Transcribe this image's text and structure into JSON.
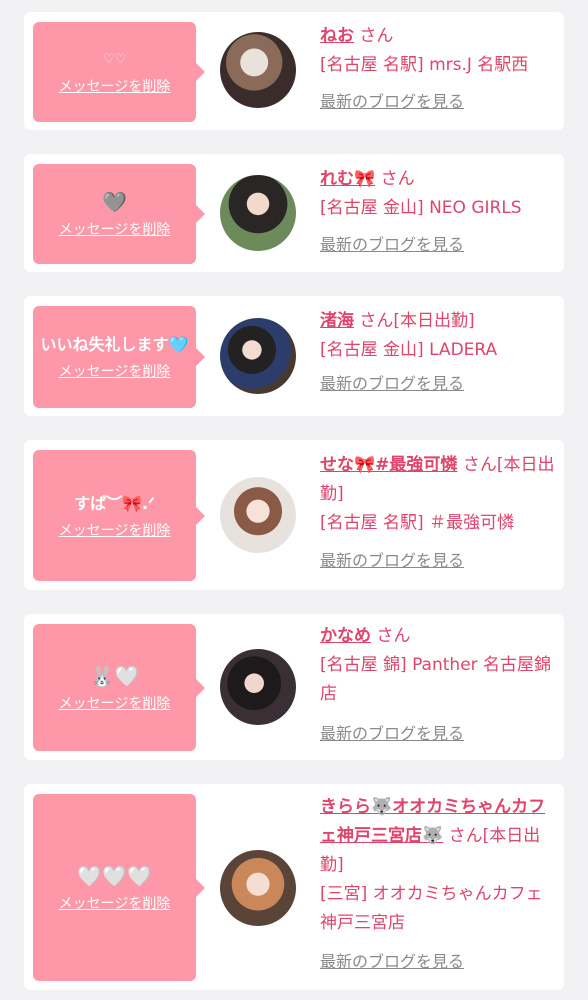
{
  "cards": [
    {
      "message": "♡♡",
      "delete_label": "メッセージを削除",
      "name": "ねお",
      "suffix": "さん",
      "shop": "[名古屋 名駅] mrs.J 名駅西",
      "blog_label": "最新のブログを見る"
    },
    {
      "message": "🩶",
      "delete_label": "メッセージを削除",
      "name": "れむ🎀",
      "suffix": "さん",
      "shop": "[名古屋 金山] NEO GIRLS",
      "blog_label": "最新のブログを見る"
    },
    {
      "message": "いいね失礼します🩵",
      "delete_label": "メッセージを削除",
      "name": "渚海",
      "suffix": "さん[本日出勤]",
      "shop": "[名古屋 金山] LADERA",
      "blog_label": "最新のブログを見る"
    },
    {
      "message": "すぱ︶🎀.ᐟ",
      "delete_label": "メッセージを削除",
      "name": "せな🎀#最強可憐",
      "suffix": "さん[本日出勤]",
      "shop": "[名古屋 名駅] ＃最強可憐",
      "blog_label": "最新のブログを見る"
    },
    {
      "message": "🐰🤍",
      "delete_label": "メッセージを削除",
      "name": "かなめ",
      "suffix": "さん",
      "shop": "[名古屋 錦] Panther 名古屋錦店",
      "blog_label": "最新のブログを見る"
    },
    {
      "message": "🤍🤍🤍",
      "delete_label": "メッセージを削除",
      "name": "きらら🐺オオカミちゃんカフェ神戸三宮店🐺",
      "suffix": "さん[本日出勤]",
      "shop": "[三宮] オオカミちゃんカフェ神戸三宮店",
      "blog_label": "最新のブログを見る"
    }
  ],
  "colors": {
    "bubble": "#fe98a8",
    "accent": "#e0446c",
    "muted": "#8a8a8a",
    "background": "#f2f2f4"
  }
}
